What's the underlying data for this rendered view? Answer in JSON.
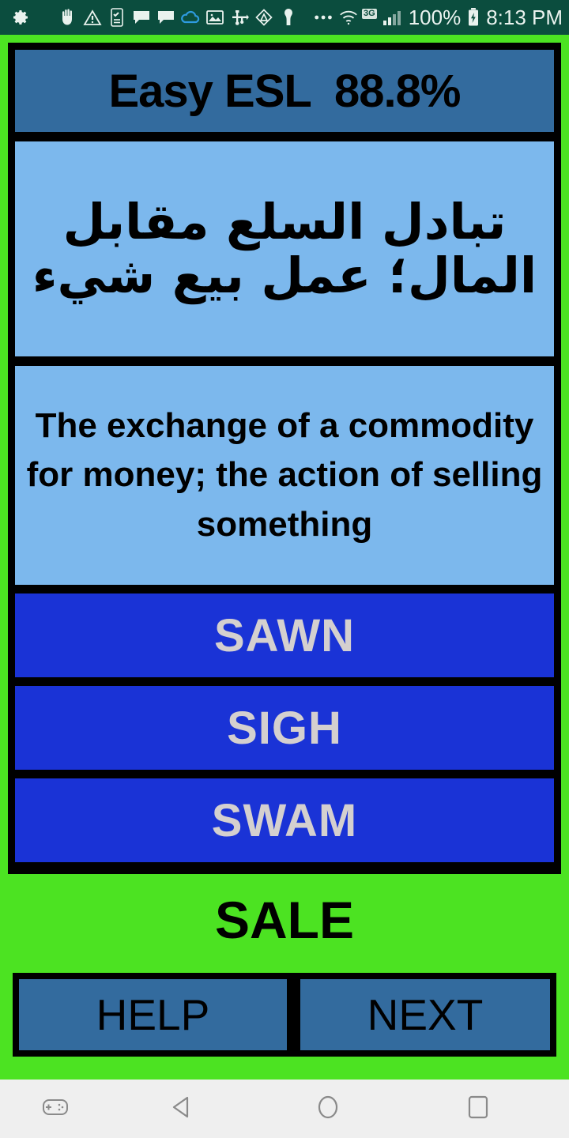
{
  "status_bar": {
    "background": "#0B4D3E",
    "left_icons": [
      "gear-icon"
    ],
    "notification_icons": [
      "hand-icon",
      "warning-triangle-icon",
      "phone-checklist-icon",
      "speech-bubble-icon",
      "speech-bubble-icon-2",
      "cloud-icon",
      "image-icon",
      "usb-icon",
      "triangle-badge-icon",
      "keyhole-icon",
      "more-dots-icon"
    ],
    "wifi_icon": "wifi-icon",
    "network_badge": "3G",
    "signal_icon": "signal-bars-icon",
    "battery_percent": "100%",
    "battery_icon": "battery-charging-icon",
    "clock": "8:13 PM"
  },
  "app": {
    "background": "#4CE322",
    "frame_color": "#000000",
    "panel_color": "#7CB8ED",
    "header_color": "#336B9E",
    "choice_color": "#1A33D6",
    "choice_text_color": "#D4D0CF"
  },
  "header": {
    "title": "Easy ESL  88.8%",
    "app_name": "Easy ESL",
    "score": "88.8%"
  },
  "prompt": {
    "arabic": "تبادل السلع مقابل المال؛ عمل بيع شيء",
    "english": "The exchange of a commodity for money; the action of selling something"
  },
  "choices": [
    {
      "label": "SAWN"
    },
    {
      "label": "SIGH"
    },
    {
      "label": "SWAM"
    }
  ],
  "answer": {
    "label": "SALE"
  },
  "bottom_bar": {
    "help_label": "HELP",
    "next_label": "NEXT"
  },
  "nav_bar": {
    "background": "#EFEFEF",
    "items": [
      {
        "name": "game-controller-icon"
      },
      {
        "name": "back-triangle-icon"
      },
      {
        "name": "home-circle-icon"
      },
      {
        "name": "recents-square-icon"
      }
    ]
  }
}
